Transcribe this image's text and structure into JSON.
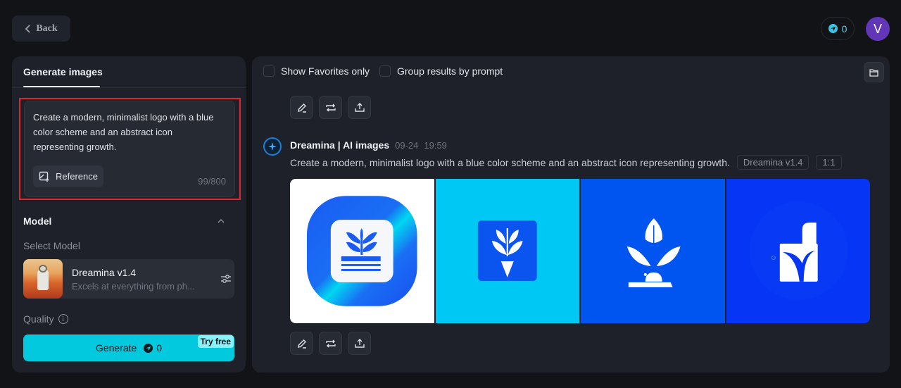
{
  "header": {
    "back_label": "Back",
    "credits": "0",
    "avatar_initial": "V"
  },
  "left_panel": {
    "tab_label": "Generate images",
    "prompt": {
      "text": "Create a modern, minimalist logo with a blue color scheme and an abstract icon representing growth.",
      "reference_label": "Reference",
      "char_count": "99/800"
    },
    "model_section": {
      "title": "Model",
      "select_label": "Select Model",
      "model_name": "Dreamina v1.4",
      "model_desc": "Excels at everything from ph..."
    },
    "quality_label": "Quality",
    "generate": {
      "label": "Generate",
      "cost": "0",
      "badge": "Try free"
    }
  },
  "right_panel": {
    "show_favorites_label": "Show Favorites only",
    "show_favorites_checked": false,
    "group_by_prompt_label": "Group results by prompt",
    "group_by_prompt_checked": false,
    "result": {
      "source": "Dreamina | AI images",
      "date": "09-24",
      "time": "19:59",
      "prompt": "Create a modern, minimalist logo with a blue color scheme and an abstract icon representing growth.",
      "tags": [
        "Dreamina v1.4",
        "1:1"
      ],
      "images": [
        {
          "description": "Blue gradient rounded square with white sprout over horizontal lines",
          "bg": "#ffffff"
        },
        {
          "description": "Cyan background with blue square and white sprout arrow",
          "bg": "#00c8f5"
        },
        {
          "description": "Blue background with white leafy plant on base",
          "bg": "#0055f0"
        },
        {
          "description": "Deep blue background with white abstract sprout book shape",
          "bg": "#0635f5"
        }
      ]
    },
    "actions": {
      "edit": "edit-icon",
      "regenerate": "regenerate-icon",
      "export": "export-icon"
    }
  },
  "colors": {
    "accent": "#03c9de",
    "highlight_border": "#e0262b",
    "avatar": "#6236b8"
  }
}
